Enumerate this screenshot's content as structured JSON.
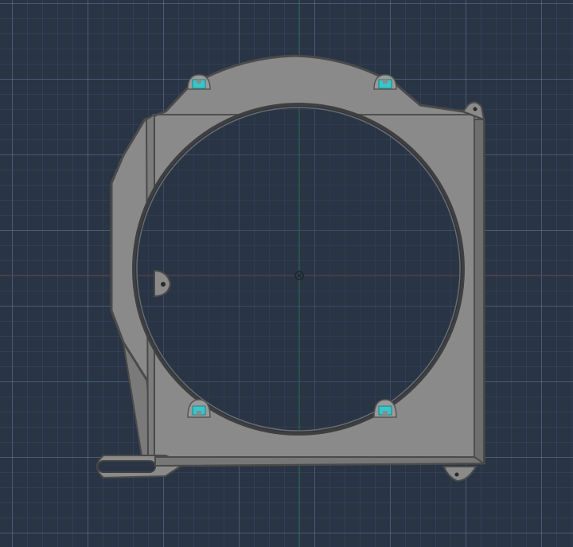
{
  "viewport": {
    "name": "3d-model-viewport",
    "background": "#293545",
    "grid_major": "#5f6f85",
    "grid_minor": "#3b4a5d"
  },
  "axes": {
    "x_axis_color": "#6b3f4c",
    "y_axis_color": "#2f6a4a"
  },
  "model": {
    "name": "fan-shroud",
    "body_color": "#8a8a8a",
    "edge_color": "#4a4a4a",
    "inner_edge_color": "#3f3f3f",
    "highlight_color": "#9c9c9c",
    "insert_color": "#35c7c9",
    "mount_tabs": [
      "mount-tab-top-right",
      "mount-tab-left",
      "mount-tab-bottom-right"
    ],
    "screw_inserts": [
      "insert-top-left",
      "insert-top-right",
      "insert-bottom-left",
      "insert-bottom-right"
    ]
  }
}
